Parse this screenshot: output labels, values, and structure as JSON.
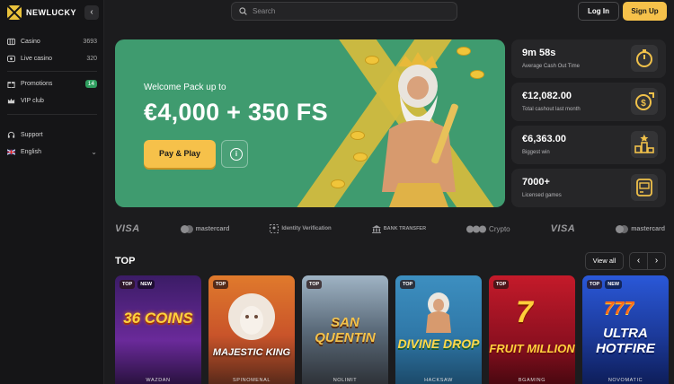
{
  "brand": {
    "name": "NEWLUCKY"
  },
  "sidebar": {
    "items": [
      {
        "label": "Casino",
        "count": "3693",
        "icon": "casino-icon"
      },
      {
        "label": "Live casino",
        "count": "320",
        "icon": "live-casino-icon"
      },
      {
        "label": "Promotions",
        "badge": "14",
        "icon": "promotions-icon"
      },
      {
        "label": "VIP club",
        "icon": "vip-crown-icon"
      },
      {
        "label": "Support",
        "icon": "headset-icon"
      },
      {
        "label": "English",
        "icon": "uk-flag-icon"
      }
    ]
  },
  "header": {
    "search_placeholder": "Search",
    "login_label": "Log In",
    "signup_label": "Sign Up"
  },
  "hero": {
    "pretitle": "Welcome Pack up to",
    "title": "€4,000 + 350 FS",
    "cta_label": "Pay & Play"
  },
  "stats": [
    {
      "value": "9m 58s",
      "label": "Average Cash Out Time",
      "icon": "stopwatch-icon"
    },
    {
      "value": "€12,082.00",
      "label": "Total cashout last month",
      "icon": "dollar-coin-icon"
    },
    {
      "value": "€6,363.00",
      "label": "Biggest win",
      "icon": "podium-icon"
    },
    {
      "value": "7000+",
      "label": "Licensed games",
      "icon": "slot-machine-icon"
    }
  ],
  "payments": [
    "VISA",
    "mastercard",
    "Identity Verification",
    "BANK TRANSFER",
    "Crypto",
    "VISA",
    "mastercard"
  ],
  "top_section": {
    "title": "TOP",
    "view_all_label": "View all",
    "games": [
      {
        "name": "36 COINS",
        "provider": "WAZDAN",
        "tags": [
          "TOP",
          "NEW"
        ],
        "color": "#5a2a80"
      },
      {
        "name": "MAJESTIC KING",
        "provider": "SPINOMENAL",
        "tags": [
          "TOP"
        ],
        "color": "#b8561e"
      },
      {
        "name": "SAN QUENTIN",
        "provider": "NOLIMIT",
        "tags": [
          "TOP"
        ],
        "color": "#5b6b7a"
      },
      {
        "name": "DIVINE DROP",
        "provider": "HACKSAW",
        "tags": [
          "TOP"
        ],
        "color": "#2c8fb0"
      },
      {
        "name": "FRUIT MILLION",
        "provider": "BGAMING",
        "tags": [
          "TOP"
        ],
        "color": "#9c1422"
      },
      {
        "name": "ULTRA HOTFIRE",
        "provider": "NOVOMATIC",
        "tags": [
          "TOP",
          "NEW"
        ],
        "color": "#1c3a9a"
      }
    ]
  }
}
